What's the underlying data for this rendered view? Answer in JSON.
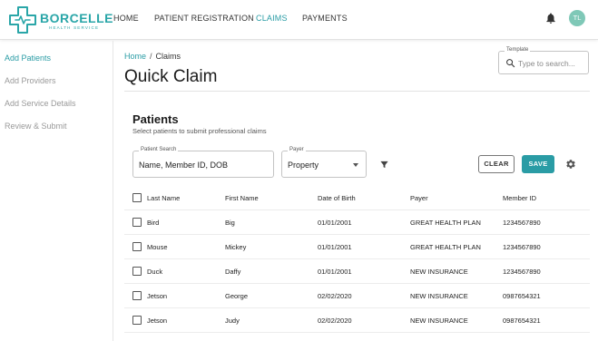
{
  "brand": {
    "name": "BORCELLE",
    "tagline": "HEALTH SERVICE",
    "accent": "#2a9ca5"
  },
  "nav": {
    "items": [
      {
        "label": "HOME",
        "active": false
      },
      {
        "label": "PATIENT REGISTRATION",
        "active": false
      },
      {
        "label": "CLAIMS",
        "active": true
      },
      {
        "label": "PAYMENTS",
        "active": false
      }
    ],
    "user_initials": "TL",
    "icons": {
      "notifications": "bell-icon"
    }
  },
  "sidebar": {
    "items": [
      {
        "label": "Add Patients",
        "active": true
      },
      {
        "label": "Add Providers",
        "active": false
      },
      {
        "label": "Add Service Details",
        "active": false
      },
      {
        "label": "Review & Submit",
        "active": false
      }
    ]
  },
  "breadcrumb": {
    "home": "Home",
    "separator": "/",
    "current": "Claims"
  },
  "page": {
    "title": "Quick Claim"
  },
  "template": {
    "label": "Template",
    "placeholder": "Type to search..."
  },
  "patients": {
    "title": "Patients",
    "subtitle": "Select patients to submit professional claims",
    "search": {
      "label": "Patient Search",
      "value": "Name, Member ID, DOB"
    },
    "payer": {
      "label": "Payer",
      "value": "Property"
    },
    "clear_label": "CLEAR",
    "save_label": "SAVE",
    "columns": [
      "Last Name",
      "First Name",
      "Date of Birth",
      "Payer",
      "Member ID"
    ],
    "rows": [
      [
        "Bird",
        "Big",
        "01/01/2001",
        "GREAT HEALTH PLAN",
        "1234567890"
      ],
      [
        "Mouse",
        "Mickey",
        "01/01/2001",
        "GREAT HEALTH PLAN",
        "1234567890"
      ],
      [
        "Duck",
        "Daffy",
        "01/01/2001",
        "NEW INSURANCE",
        "1234567890"
      ],
      [
        "Jetson",
        "George",
        "02/02/2020",
        "NEW INSURANCE",
        "0987654321"
      ],
      [
        "Jetson",
        "Judy",
        "02/02/2020",
        "NEW INSURANCE",
        "0987654321"
      ]
    ]
  }
}
